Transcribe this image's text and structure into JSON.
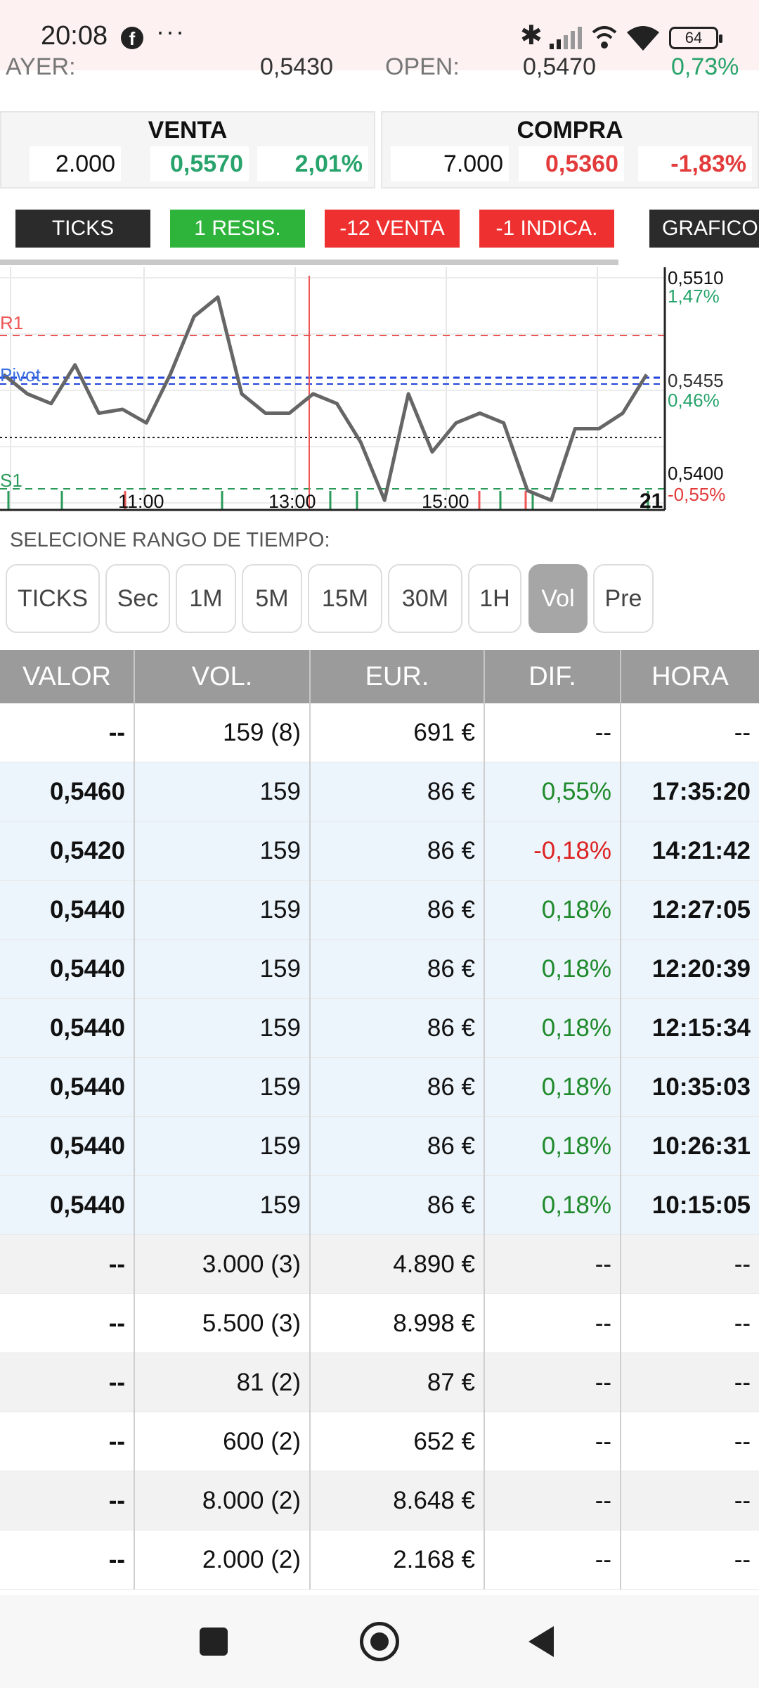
{
  "status_bar": {
    "time": "20:08",
    "facebook_icon": "f",
    "more": "···",
    "battery": "64"
  },
  "top_cut": {
    "ayer_label": "AYER:",
    "ayer_value": "0,5430",
    "open_label": "OPEN:",
    "open_value": "0,5470",
    "open_pct": "0,73%"
  },
  "venta": {
    "title": "VENTA",
    "qty": "2.000",
    "price": "0,5570",
    "pct": "2,01%"
  },
  "compra": {
    "title": "COMPRA",
    "qty": "7.000",
    "price": "0,5360",
    "pct": "-1,83%"
  },
  "signals": [
    "TICKS",
    "1 RESIS.",
    "-12 VENTA",
    "-1 INDICA.",
    "GRAFICO I"
  ],
  "chart": {
    "labels": {
      "r1": "R1",
      "pivot": "Pivot",
      "s1": "S1"
    },
    "right_axis": {
      "top": "0,5510",
      "top_pct": "1,47%",
      "mid": "0,5455",
      "mid_pct": "0,46%",
      "bottom": "0,5400",
      "bottom_pct": "-0,55%"
    },
    "x_ticks": [
      "11:00",
      "13:00",
      "15:00"
    ],
    "x_end": "21"
  },
  "chart_data": {
    "type": "line",
    "x_ticks": [
      "11:00",
      "13:00",
      "15:00"
    ],
    "ylim": [
      0.539,
      0.551
    ],
    "levels": {
      "R1": 0.548,
      "Pivot": 0.5455,
      "S1": 0.54
    },
    "price_line": [
      0.546,
      0.545,
      0.5445,
      0.5465,
      0.544,
      0.5442,
      0.5435,
      0.546,
      0.549,
      0.55,
      0.545,
      0.544,
      0.544,
      0.545,
      0.5445,
      0.5425,
      0.5395,
      0.545,
      0.542,
      0.5435,
      0.544,
      0.5435,
      0.54,
      0.5395,
      0.5432,
      0.5432,
      0.544,
      0.546
    ]
  },
  "range": {
    "label": "SELECIONE RANGO DE TIEMPO:",
    "buttons": [
      "TICKS",
      "Sec",
      "1M",
      "5M",
      "15M",
      "30M",
      "1H",
      "Vol",
      "Pre"
    ],
    "active": "Vol"
  },
  "table": {
    "headers": [
      "VALOR",
      "VOL.",
      "EUR.",
      "DIF.",
      "HORA"
    ],
    "rows": [
      {
        "valor": "--",
        "vol": "159 (8)",
        "eur": "691 €",
        "dif": "--",
        "hora": "--",
        "style": "white"
      },
      {
        "valor": "0,5460",
        "vol": "159",
        "eur": "86 €",
        "dif": "0,55%",
        "hora": "17:35:20",
        "style": "blue",
        "dif_color": "green"
      },
      {
        "valor": "0,5420",
        "vol": "159",
        "eur": "86 €",
        "dif": "-0,18%",
        "hora": "14:21:42",
        "style": "blue",
        "dif_color": "red"
      },
      {
        "valor": "0,5440",
        "vol": "159",
        "eur": "86 €",
        "dif": "0,18%",
        "hora": "12:27:05",
        "style": "blue",
        "dif_color": "green"
      },
      {
        "valor": "0,5440",
        "vol": "159",
        "eur": "86 €",
        "dif": "0,18%",
        "hora": "12:20:39",
        "style": "blue",
        "dif_color": "green"
      },
      {
        "valor": "0,5440",
        "vol": "159",
        "eur": "86 €",
        "dif": "0,18%",
        "hora": "12:15:34",
        "style": "blue",
        "dif_color": "green"
      },
      {
        "valor": "0,5440",
        "vol": "159",
        "eur": "86 €",
        "dif": "0,18%",
        "hora": "10:35:03",
        "style": "blue",
        "dif_color": "green"
      },
      {
        "valor": "0,5440",
        "vol": "159",
        "eur": "86 €",
        "dif": "0,18%",
        "hora": "10:26:31",
        "style": "blue",
        "dif_color": "green"
      },
      {
        "valor": "0,5440",
        "vol": "159",
        "eur": "86 €",
        "dif": "0,18%",
        "hora": "10:15:05",
        "style": "blue",
        "dif_color": "green"
      },
      {
        "valor": "--",
        "vol": "3.000 (3)",
        "eur": "4.890 €",
        "dif": "--",
        "hora": "--",
        "style": "grey"
      },
      {
        "valor": "--",
        "vol": "5.500 (3)",
        "eur": "8.998 €",
        "dif": "--",
        "hora": "--",
        "style": "white"
      },
      {
        "valor": "--",
        "vol": "81 (2)",
        "eur": "87 €",
        "dif": "--",
        "hora": "--",
        "style": "grey"
      },
      {
        "valor": "--",
        "vol": "600 (2)",
        "eur": "652 €",
        "dif": "--",
        "hora": "--",
        "style": "white"
      },
      {
        "valor": "--",
        "vol": "8.000 (2)",
        "eur": "8.648 €",
        "dif": "--",
        "hora": "--",
        "style": "grey"
      },
      {
        "valor": "--",
        "vol": "2.000 (2)",
        "eur": "2.168 €",
        "dif": "--",
        "hora": "--",
        "style": "white"
      }
    ]
  },
  "colors": {
    "green": "#27a36b",
    "red": "#e33b3b",
    "header_grey": "#9b9b9b",
    "row_blue": "#ecf4fc"
  }
}
